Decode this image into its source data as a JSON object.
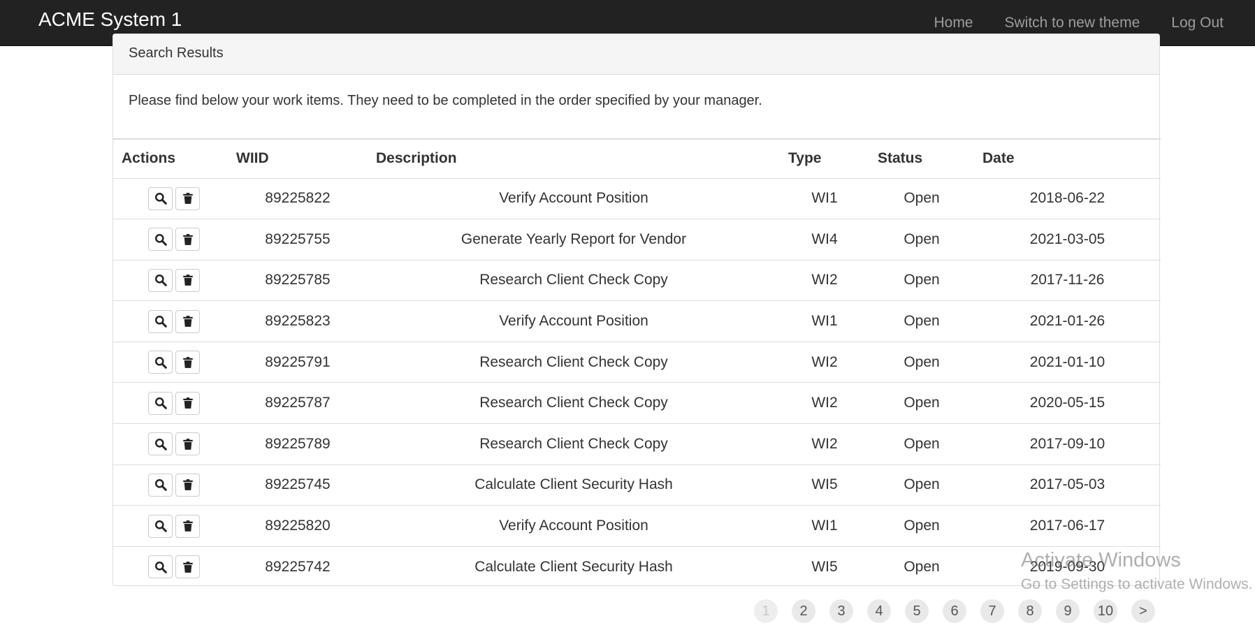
{
  "navbar": {
    "brand": "ACME System 1",
    "links": [
      "Home",
      "Switch to new theme",
      "Log Out"
    ]
  },
  "panel": {
    "heading": "Search Results",
    "intro": "Please find below your work items. They need to be completed in the order specified by your manager."
  },
  "table": {
    "headers": [
      "Actions",
      "WIID",
      "Description",
      "Type",
      "Status",
      "Date"
    ],
    "rows": [
      {
        "wiid": "89225822",
        "description": "Verify Account Position",
        "type": "WI1",
        "status": "Open",
        "date": "2018-06-22"
      },
      {
        "wiid": "89225755",
        "description": "Generate Yearly Report for Vendor",
        "type": "WI4",
        "status": "Open",
        "date": "2021-03-05"
      },
      {
        "wiid": "89225785",
        "description": "Research Client Check Copy",
        "type": "WI2",
        "status": "Open",
        "date": "2017-11-26"
      },
      {
        "wiid": "89225823",
        "description": "Verify Account Position",
        "type": "WI1",
        "status": "Open",
        "date": "2021-01-26"
      },
      {
        "wiid": "89225791",
        "description": "Research Client Check Copy",
        "type": "WI2",
        "status": "Open",
        "date": "2021-01-10"
      },
      {
        "wiid": "89225787",
        "description": "Research Client Check Copy",
        "type": "WI2",
        "status": "Open",
        "date": "2020-05-15"
      },
      {
        "wiid": "89225789",
        "description": "Research Client Check Copy",
        "type": "WI2",
        "status": "Open",
        "date": "2017-09-10"
      },
      {
        "wiid": "89225745",
        "description": "Calculate Client Security Hash",
        "type": "WI5",
        "status": "Open",
        "date": "2017-05-03"
      },
      {
        "wiid": "89225820",
        "description": "Verify Account Position",
        "type": "WI1",
        "status": "Open",
        "date": "2017-06-17"
      },
      {
        "wiid": "89225742",
        "description": "Calculate Client Security Hash",
        "type": "WI5",
        "status": "Open",
        "date": "2019-09-30"
      }
    ],
    "row_actions": [
      "search-icon",
      "trash-icon"
    ]
  },
  "pagination": {
    "pages": [
      "1",
      "2",
      "3",
      "4",
      "5",
      "6",
      "7",
      "8",
      "9",
      "10",
      ">"
    ],
    "current": "1"
  },
  "watermark": {
    "title": "Activate Windows",
    "subtitle": "Go to Settings to activate Windows."
  }
}
